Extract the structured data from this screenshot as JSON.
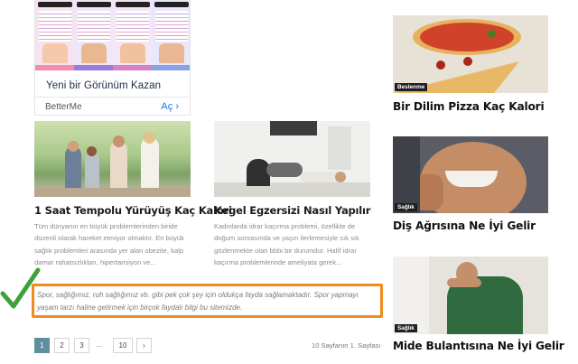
{
  "ad": {
    "title": "Yeni bir Görünüm Kazan",
    "brand": "BetterMe",
    "cta": "Aç"
  },
  "posts": [
    {
      "title": "1 Saat Tempolu Yürüyüş Kaç Kalori",
      "excerpt": "Tüm dünyanın en büyük problemlerinden biride düzenli olarak hareket etmiyor olmaktır. En büyük sağlık problemleri arasında yer alan obezite, kalp damar rahatsızlıkları, hipertansiyon ve..."
    },
    {
      "title": "Kegel Egzersizi Nasıl Yapılır",
      "excerpt": "Kadınlarda idrar kaçırma problemi, özellikle de doğum sonrasında ve yaşın ilerlemesiyle sık sık gözlenmekte olan bbbi bir durumdur. Hafif idrar kaçırma problemlerinde ameliyata gerek..."
    }
  ],
  "note": "Spor, sağlığımız, ruh sağlığımız vb. gibi pek çok şey için oldukça fayda sağlamaktadır. Spor yapmayı yaşam tarzı haline getirmek için birçok faydalı bilgi bu sitemizde.",
  "pagination": {
    "pages": [
      "1",
      "2",
      "3"
    ],
    "dots": "...",
    "last": "10",
    "next": "›",
    "info": "10 Sayfanın 1. Sayfası"
  },
  "sidebar": [
    {
      "badge": "Beslenme",
      "title": "Bir Dilim Pizza Kaç Kalori"
    },
    {
      "badge": "Sağlık",
      "title": "Diş Ağrısına Ne İyi Gelir"
    },
    {
      "badge": "Sağlık",
      "title": "Mide Bulantısına Ne İyi Gelir"
    }
  ],
  "colors": {
    "highlight": "#f08a1c",
    "check": "#3aa335",
    "pagination_active": "#5e8ea0"
  }
}
